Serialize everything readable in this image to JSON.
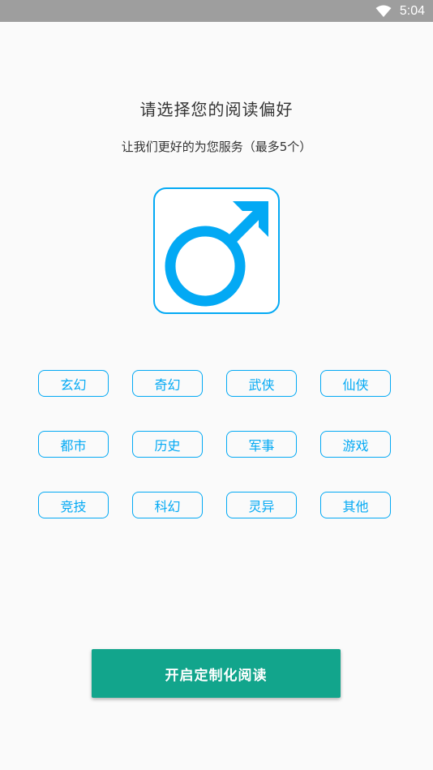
{
  "status_bar": {
    "time": "5:04",
    "wifi_icon": "wifi-icon"
  },
  "header": {
    "title": "请选择您的阅读偏好",
    "subtitle": "让我们更好的为您服务（最多5个）"
  },
  "gender_selector": {
    "icon": "male-symbol-icon",
    "color": "#03a9f4"
  },
  "tags": [
    {
      "label": "玄幻"
    },
    {
      "label": "奇幻"
    },
    {
      "label": "武侠"
    },
    {
      "label": "仙侠"
    },
    {
      "label": "都市"
    },
    {
      "label": "历史"
    },
    {
      "label": "军事"
    },
    {
      "label": "游戏"
    },
    {
      "label": "竞技"
    },
    {
      "label": "科幻"
    },
    {
      "label": "灵异"
    },
    {
      "label": "其他"
    }
  ],
  "start_button": {
    "label": "开启定制化阅读",
    "color": "#12a58c"
  }
}
